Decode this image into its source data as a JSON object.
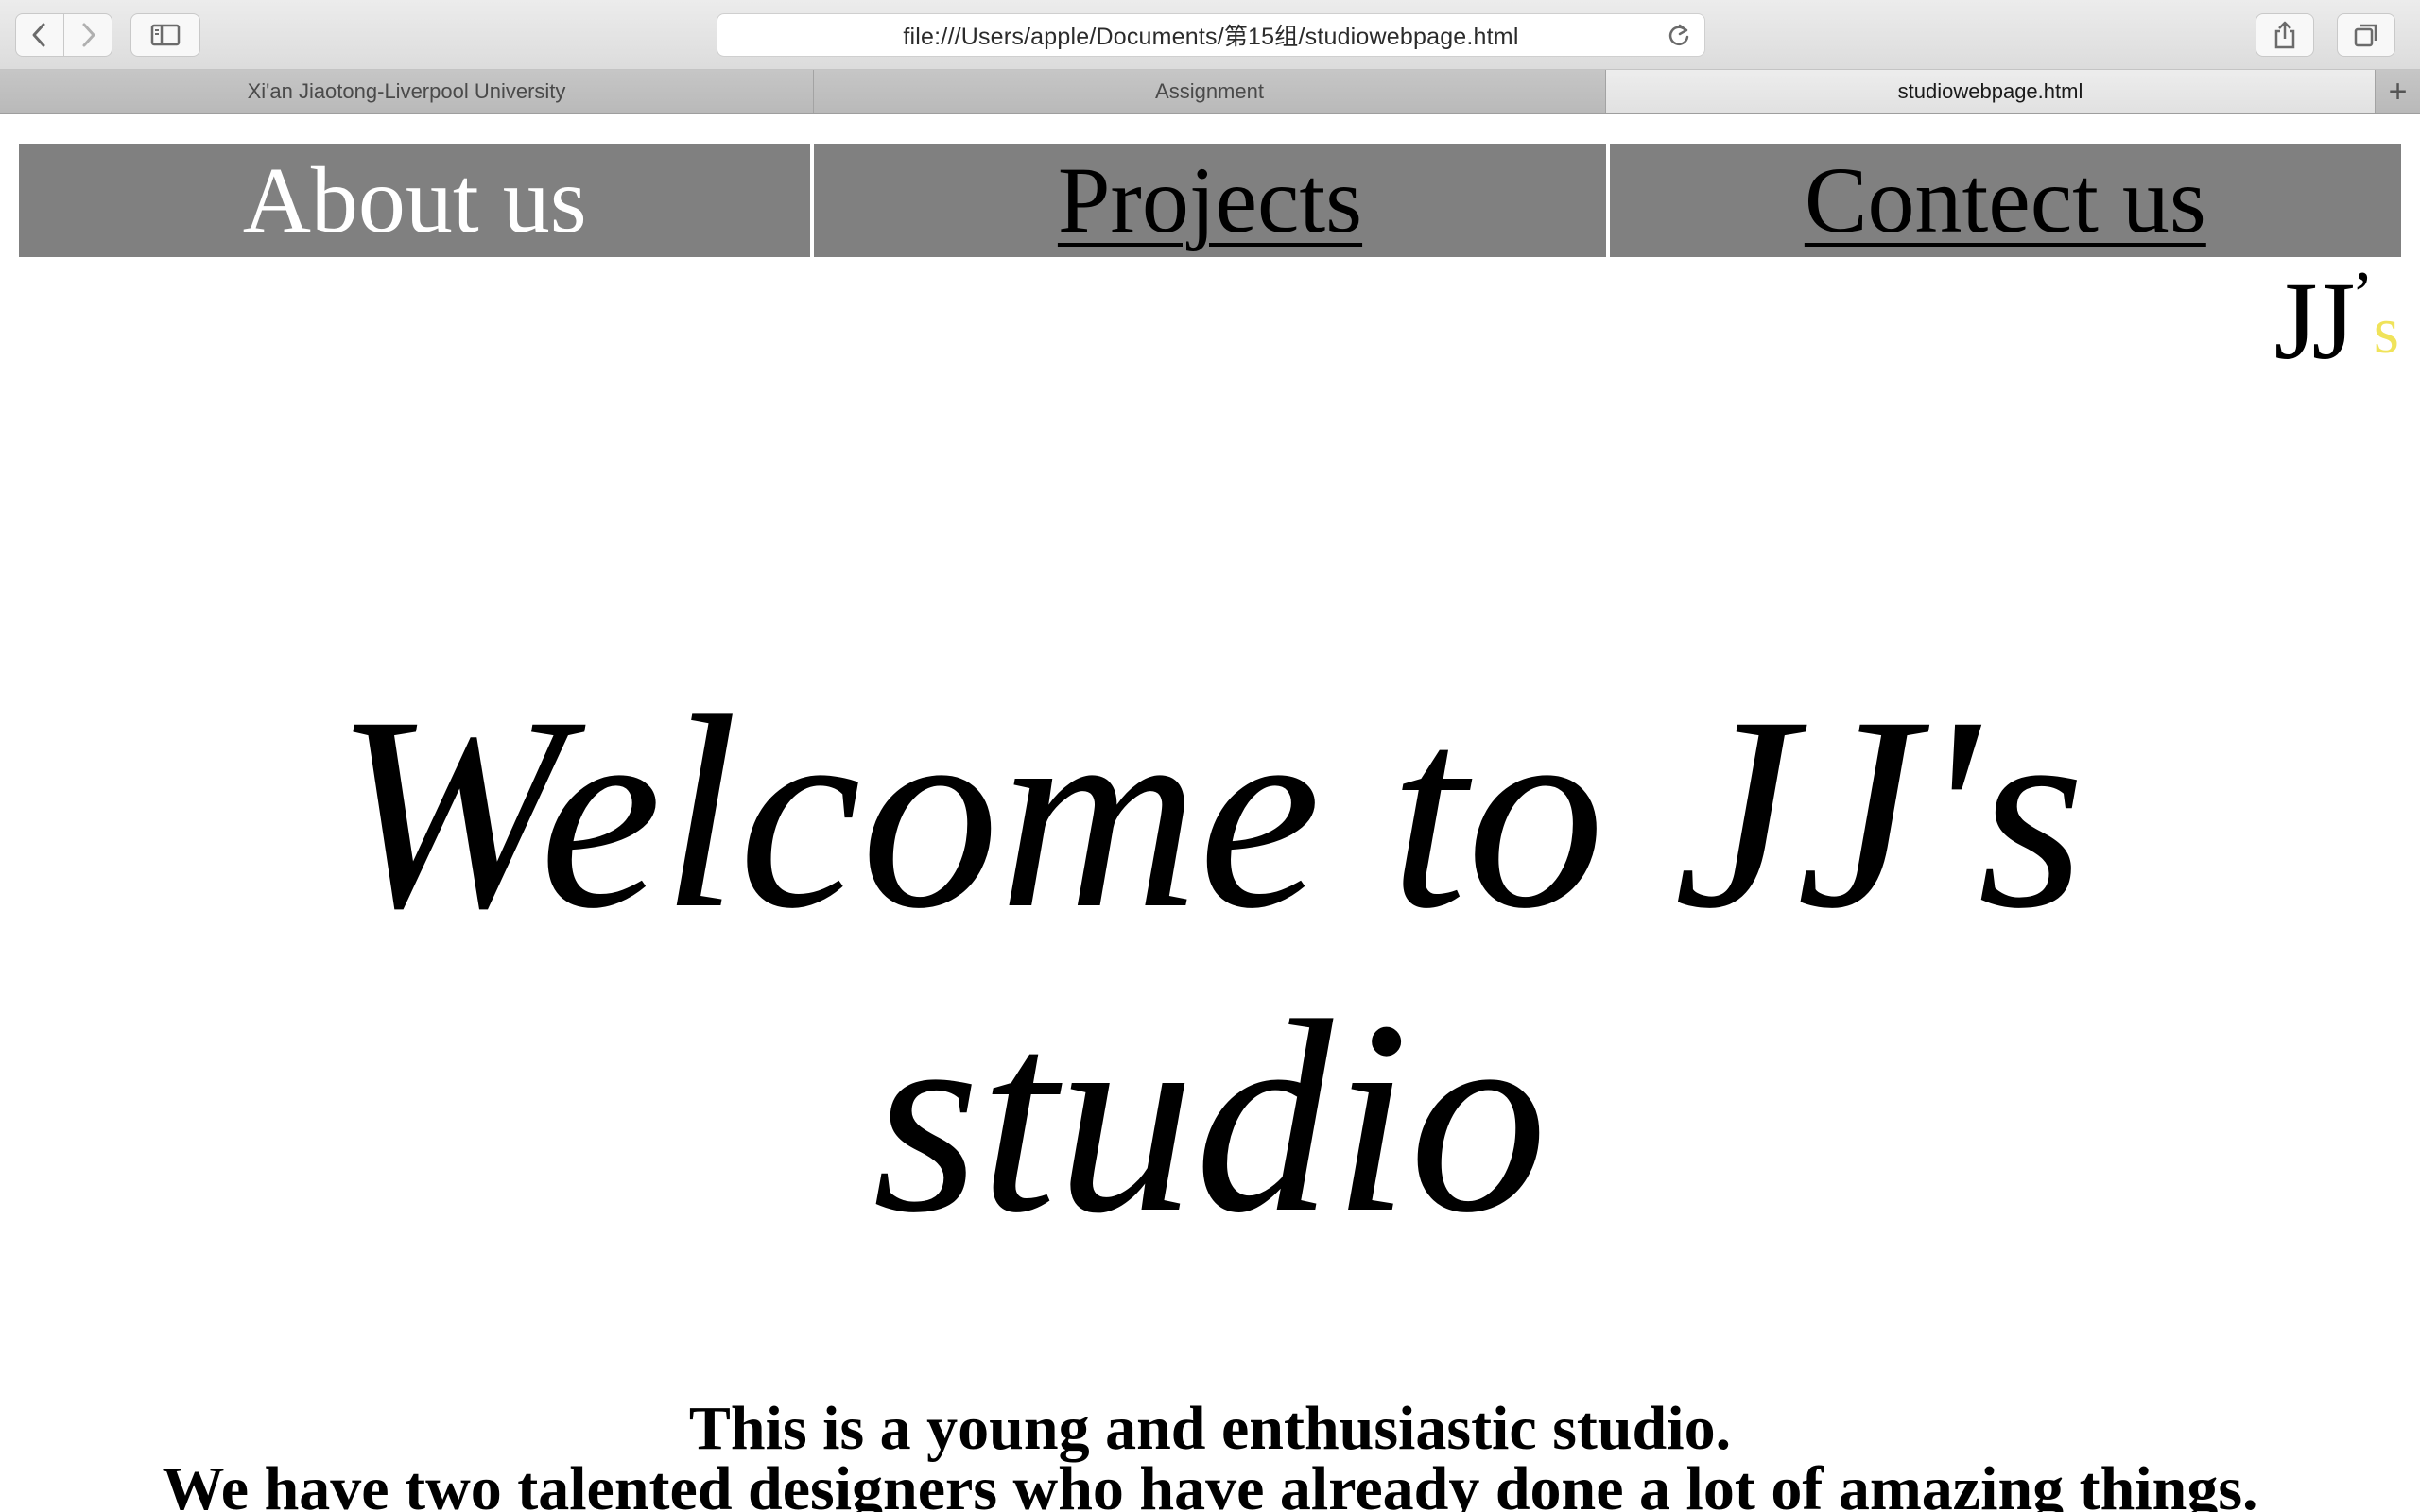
{
  "browser": {
    "url": "file:///Users/apple/Documents/第15组/studiowebpage.html",
    "tabs": [
      {
        "label": "Xi'an Jiaotong-Liverpool University",
        "active": false
      },
      {
        "label": "Assignment",
        "active": false
      },
      {
        "label": "studiowebpage.html",
        "active": true
      }
    ],
    "new_tab_label": "+",
    "icons": {
      "back": "chevron-left-icon",
      "forward": "chevron-right-icon",
      "sidebar": "sidebar-icon",
      "reload": "reload-icon",
      "share": "share-icon",
      "tabs_overview": "tabs-overview-icon"
    }
  },
  "nav": {
    "items": [
      {
        "label": "About us"
      },
      {
        "label": "Projects"
      },
      {
        "label": "Contect us"
      }
    ],
    "background_color": "#808080"
  },
  "logo": {
    "main": "JJ",
    "apostrophe": "’",
    "suffix": "s",
    "suffix_color": "#f0e35a"
  },
  "hero": {
    "line1": "Welcome to JJ's",
    "line2": "studio"
  },
  "intro": {
    "line1": "This is a young and enthusiastic studio.",
    "line2": "We have two talented designers who have already done a lot of amazing things."
  }
}
